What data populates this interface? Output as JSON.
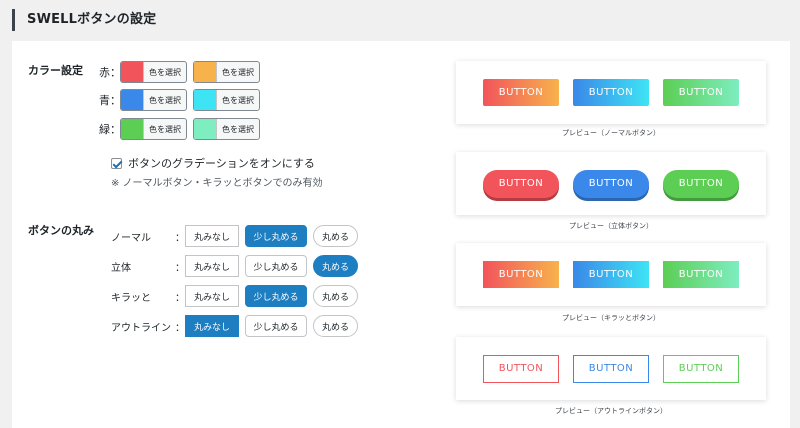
{
  "page": {
    "title": "SWELLボタンの設定"
  },
  "colors": {
    "red_main": "#f2545b",
    "red_grad": "#f8b24c",
    "blue_main": "#3a88e9",
    "blue_grad": "#3fe4f4",
    "green_main": "#5cce54",
    "green_grad": "#7eedc0"
  },
  "color_settings": {
    "label": "カラー設定",
    "picker_text": "色を選択",
    "rows": [
      {
        "label": "赤："
      },
      {
        "label": "青："
      },
      {
        "label": "緑："
      }
    ],
    "gradation_checkbox": {
      "label": "ボタンのグラデーションをオンにする",
      "checked": true
    },
    "note": "※ ノーマルボタン・キラッとボタンでのみ有効"
  },
  "rounding": {
    "label": "ボタンの丸み",
    "colon": "：",
    "options": [
      "丸みなし",
      "少し丸める",
      "丸める"
    ],
    "rows": [
      {
        "name": "ノーマル",
        "selected": "少し丸める"
      },
      {
        "name": "立体",
        "selected": "丸める"
      },
      {
        "name": "キラッと",
        "selected": "少し丸める"
      },
      {
        "name": "アウトライン",
        "selected": "丸みなし"
      }
    ]
  },
  "previews": {
    "button_text": "BUTTON",
    "normal_caption": "プレビュー（ノーマルボタン）",
    "3d_caption": "プレビュー（立体ボタン）",
    "kira_caption": "プレビュー（キラッとボタン）",
    "outline_caption": "プレビュー（アウトラインボタン）"
  }
}
